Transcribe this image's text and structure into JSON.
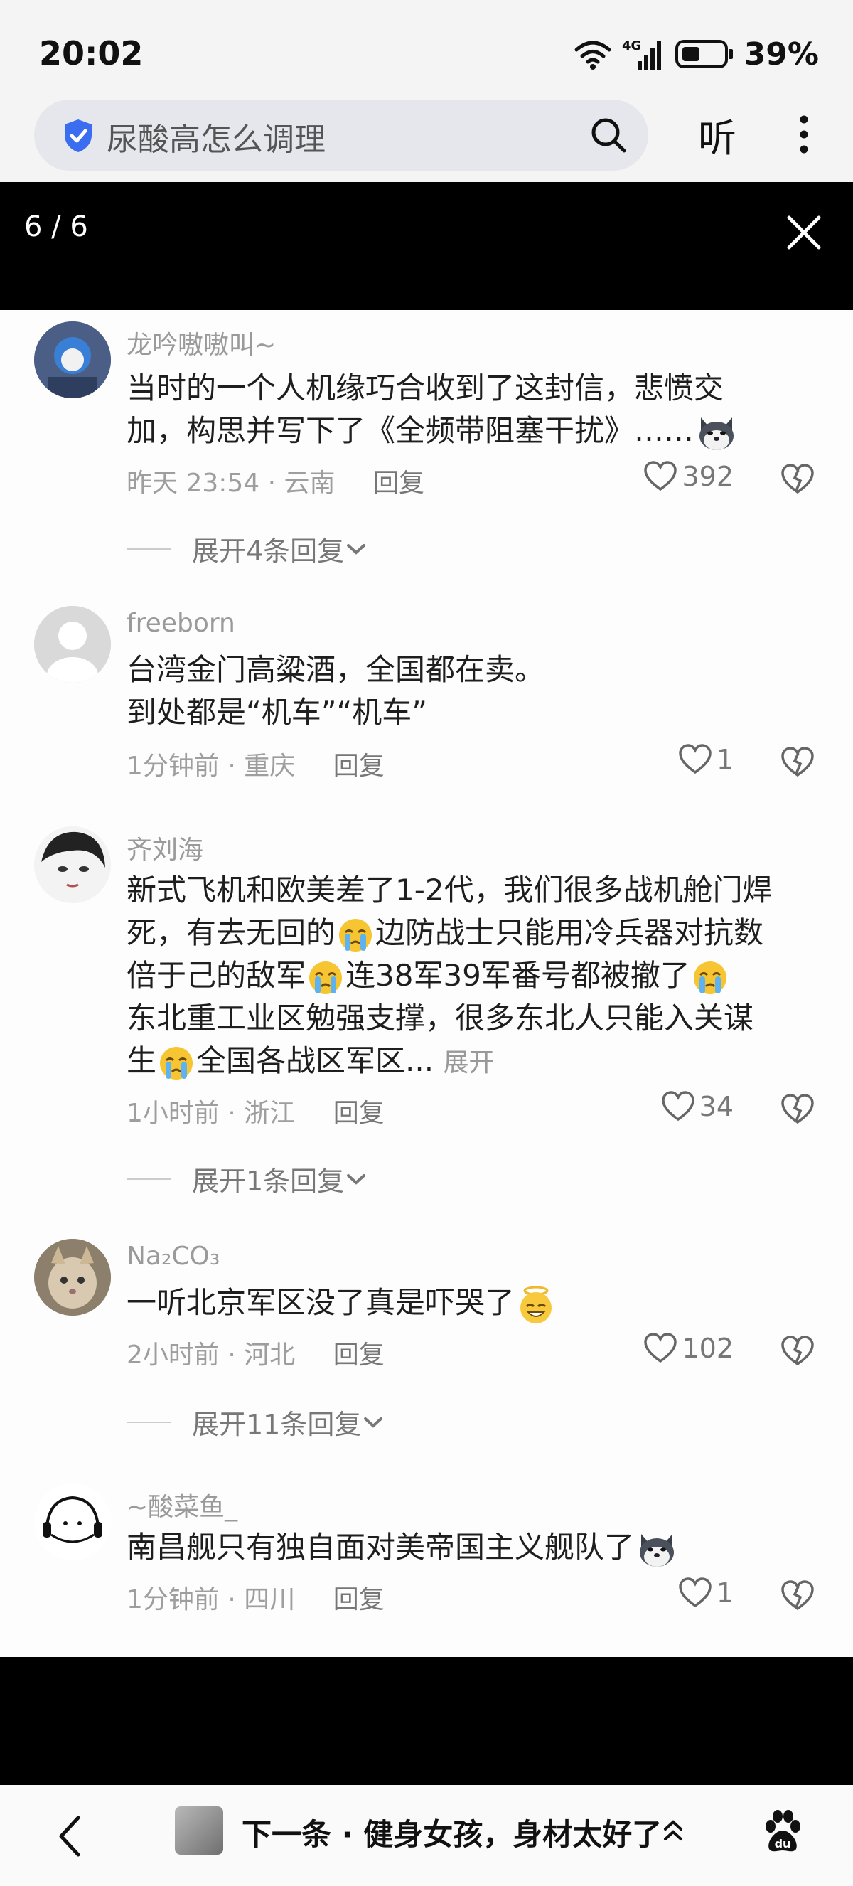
{
  "status_bar": {
    "time": "20:02",
    "network": "4G",
    "battery": "39%"
  },
  "search": {
    "query": "尿酸高怎么调理",
    "listen_label": "听"
  },
  "overlay": {
    "page_count": "6 / 6"
  },
  "comments": [
    {
      "username": "龙吟嗷嗷叫~",
      "lines": [
        "当时的一个人机缘巧合收到了这封信，悲愤交",
        "加，构思并写下了《全频带阻塞干扰》……"
      ],
      "time": "昨天 23:54",
      "location": "云南",
      "reply_label": "回复",
      "likes": "392",
      "expand": "展开4条回复"
    },
    {
      "username": "freeborn",
      "lines": [
        "台湾金门高粱酒，全国都在卖。",
        "到处都是“机车”“机车”"
      ],
      "time": "1分钟前",
      "location": "重庆",
      "reply_label": "回复",
      "likes": "1"
    },
    {
      "username": "齐刘海",
      "segments": {
        "l1": "新式飞机和欧美差了1-2代，我们很多战机舱门焊",
        "l2a": "死，有去无回的",
        "l2b": "边防战士只能用冷兵器对抗数",
        "l3a": "倍于己的敌军",
        "l3b": "连38军39军番号都被撤了",
        "l4": "东北重工业区勉强支撑，很多东北人只能入关谋",
        "l5a": "生",
        "l5b": "全国各战区军区...",
        "more": "展开"
      },
      "time": "1小时前",
      "location": "浙江",
      "reply_label": "回复",
      "likes": "34",
      "expand": "展开1条回复"
    },
    {
      "username": "Na₂CO₃",
      "lines": [
        "一听北京军区没了真是吓哭了"
      ],
      "time": "2小时前",
      "location": "河北",
      "reply_label": "回复",
      "likes": "102",
      "expand": "展开11条回复"
    },
    {
      "username": "~酸菜鱼_",
      "lines": [
        "南昌舰只有独自面对美帝国主义舰队了"
      ],
      "time": "1分钟前",
      "location": "四川",
      "reply_label": "回复",
      "likes": "1"
    }
  ],
  "bottom": {
    "next_label": "下一条 · 健身女孩，身材太好了"
  },
  "icons": [
    "wifi-icon",
    "signal-icon",
    "battery-icon",
    "shield-icon",
    "search-icon",
    "more-icon",
    "close-icon",
    "heart-icon",
    "dislike-icon",
    "chevron-down-icon",
    "doge-emoji",
    "crying-emoji",
    "halo-emoji",
    "back-icon",
    "chevron-up-icon",
    "baidu-paw-icon"
  ],
  "colors": {
    "background": "#f4f4f4",
    "search_box": "#e6e7ec",
    "shield_blue": "#3a6df0",
    "overlay": "#000000",
    "muted_text": "#9a9a9a"
  }
}
